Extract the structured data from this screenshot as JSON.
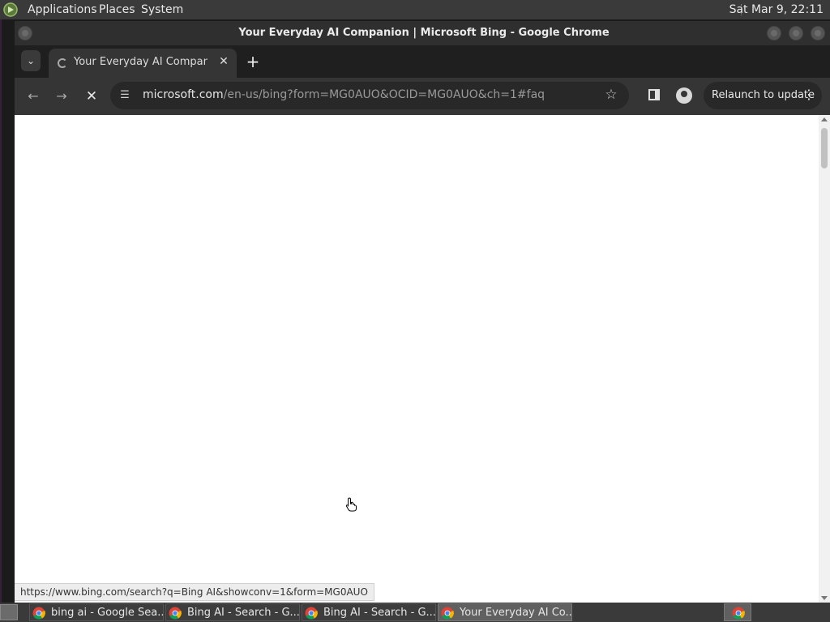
{
  "top_panel": {
    "menus": [
      "Applications",
      "Places",
      "System"
    ],
    "clock": "Sat Mar  9, 22:11"
  },
  "window": {
    "title": "Your Everyday AI Companion | Microsoft Bing - Google Chrome"
  },
  "tabs": [
    {
      "label": "Your Everyday AI Companion",
      "active": true
    }
  ],
  "toolbar": {
    "url_host": "microsoft.com",
    "url_path": "/en-us/bing?form=MG0AUO&OCID=MG0AUO&ch=1#faq",
    "relaunch_label": "Relaunch to update",
    "loading": true
  },
  "status_bar": {
    "hover_link": "https://www.bing.com/search?q=Bing AI&showconv=1&form=MG0AUO"
  },
  "taskbar": {
    "tasks": [
      {
        "label": "bing ai - Google Sea...",
        "active": false
      },
      {
        "label": "Bing AI - Search - G...",
        "active": false
      },
      {
        "label": "Bing AI - Search - G...",
        "active": false
      },
      {
        "label": "Your Everyday AI Co...",
        "active": true
      }
    ]
  },
  "icons": {
    "os_logo": "mate-logo-icon",
    "tab_search": "tab-search-chevron-icon",
    "favicon": "loading-spinner-icon",
    "close": "close-icon",
    "new_tab": "plus-icon",
    "back": "arrow-left-icon",
    "forward": "arrow-right-icon",
    "stop": "stop-x-icon",
    "site_info": "tune-icon",
    "bookmark": "star-icon",
    "side_panel": "side-panel-icon",
    "profile": "profile-icon",
    "menu": "kebab-menu-icon",
    "cursor": "hand-pointer-icon",
    "app": "chrome-icon"
  },
  "colors": {
    "panel": "#3a3a3a",
    "toolbar": "#353535",
    "tabstrip": "#1f1f1f",
    "omnibox": "#282828",
    "page": "#ffffff"
  }
}
